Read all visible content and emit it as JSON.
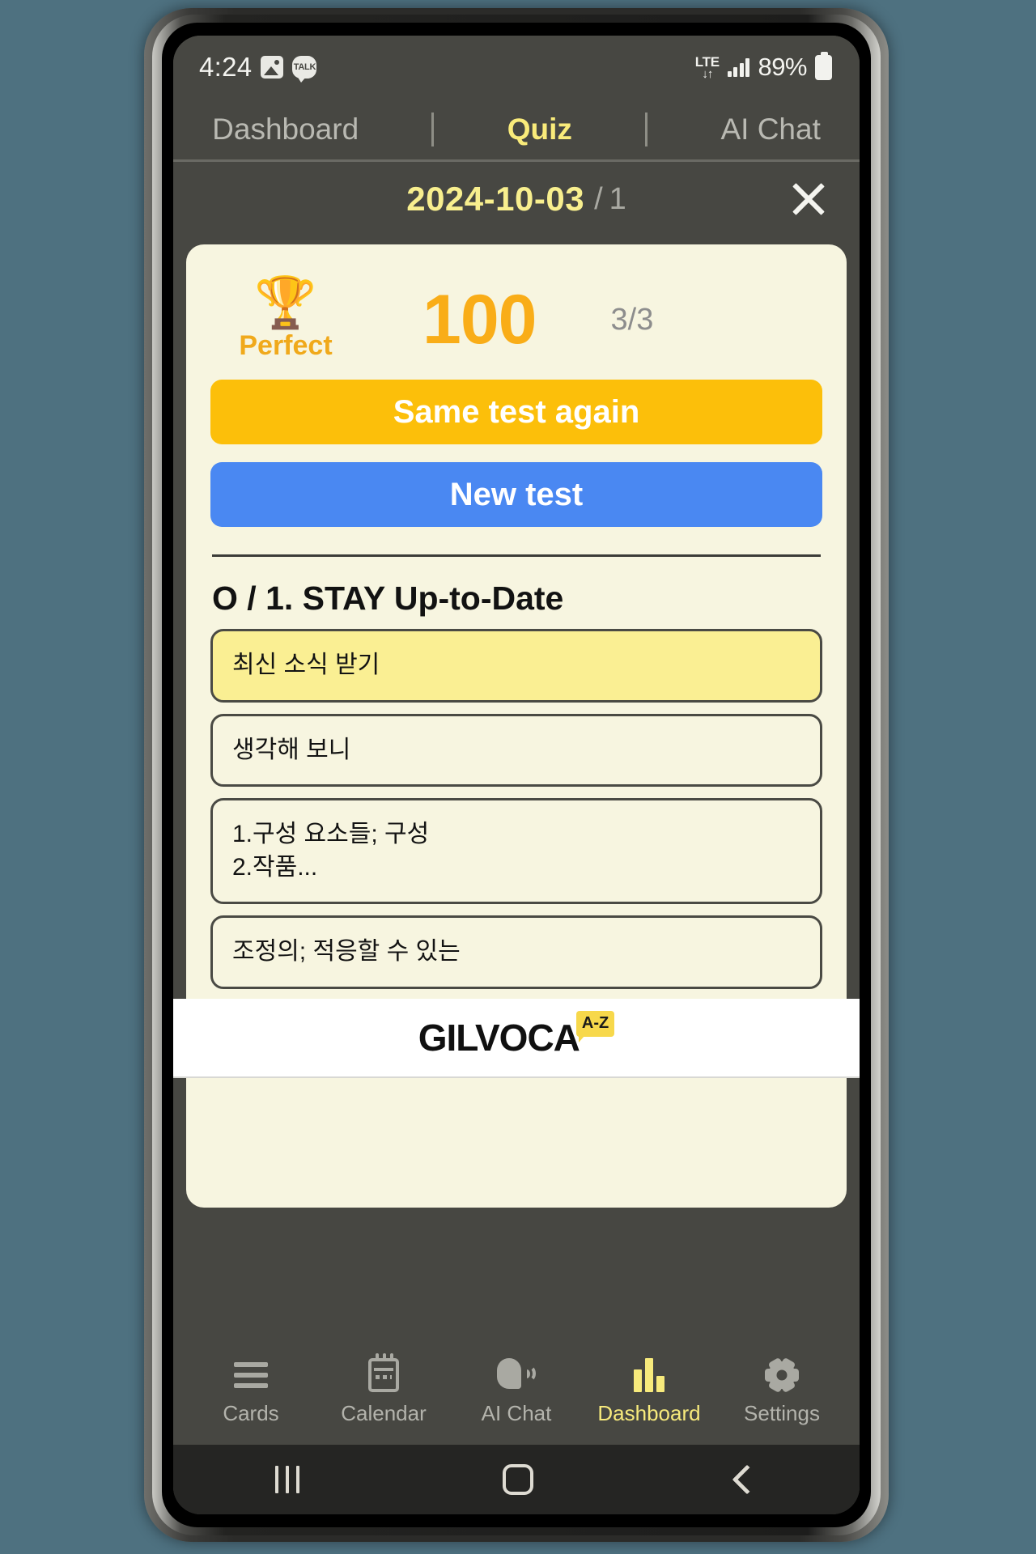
{
  "statusbar": {
    "time": "4:24",
    "photo_icon": "image-icon",
    "talk_icon_label": "TALK",
    "network": "LTE",
    "network_arrows": "↓↑",
    "battery_percent": "89%"
  },
  "top_tabs": [
    {
      "label": "Dashboard",
      "active": false
    },
    {
      "label": "Quiz",
      "active": true
    },
    {
      "label": "AI Chat",
      "active": false
    }
  ],
  "quiz_header": {
    "date": "2024-10-03",
    "separator": "/",
    "index": "1",
    "close_label": "×"
  },
  "result": {
    "trophy": "🏆",
    "badge_label": "Perfect",
    "score": "100",
    "ratio": "3/3",
    "same_test_label": "Same test again",
    "new_test_label": "New test"
  },
  "question": {
    "title": "O / 1. STAY Up-to-Date",
    "options": [
      {
        "text": "최신 소식 받기",
        "selected": true
      },
      {
        "text": "생각해 보니",
        "selected": false
      },
      {
        "text": "1.구성 요소들; 구성\n2.작품...",
        "selected": false
      },
      {
        "text": "조정의; 적응할 수 있는",
        "selected": false
      }
    ]
  },
  "ad": {
    "logo_text": "GILVOCA",
    "logo_badge": "A-Z"
  },
  "bottom_nav": [
    {
      "label": "Cards",
      "icon": "cards-icon",
      "active": false
    },
    {
      "label": "Calendar",
      "icon": "calendar-icon",
      "active": false
    },
    {
      "label": "AI Chat",
      "icon": "ai-chat-icon",
      "active": false
    },
    {
      "label": "Dashboard",
      "icon": "bar-chart-icon",
      "active": true
    },
    {
      "label": "Settings",
      "icon": "gear-icon",
      "active": false
    }
  ],
  "android_nav": {
    "recents": "recents-icon",
    "home": "home-icon",
    "back": "back-icon"
  },
  "colors": {
    "background": "#4e7180",
    "screen_bg": "#474742",
    "card_bg": "#f7f5e0",
    "accent_yellow": "#f9eb7a",
    "amber_button": "#fcbf0a",
    "blue_button": "#4a88f2",
    "score_orange": "#f9ad18",
    "selected_option": "#faef93"
  }
}
